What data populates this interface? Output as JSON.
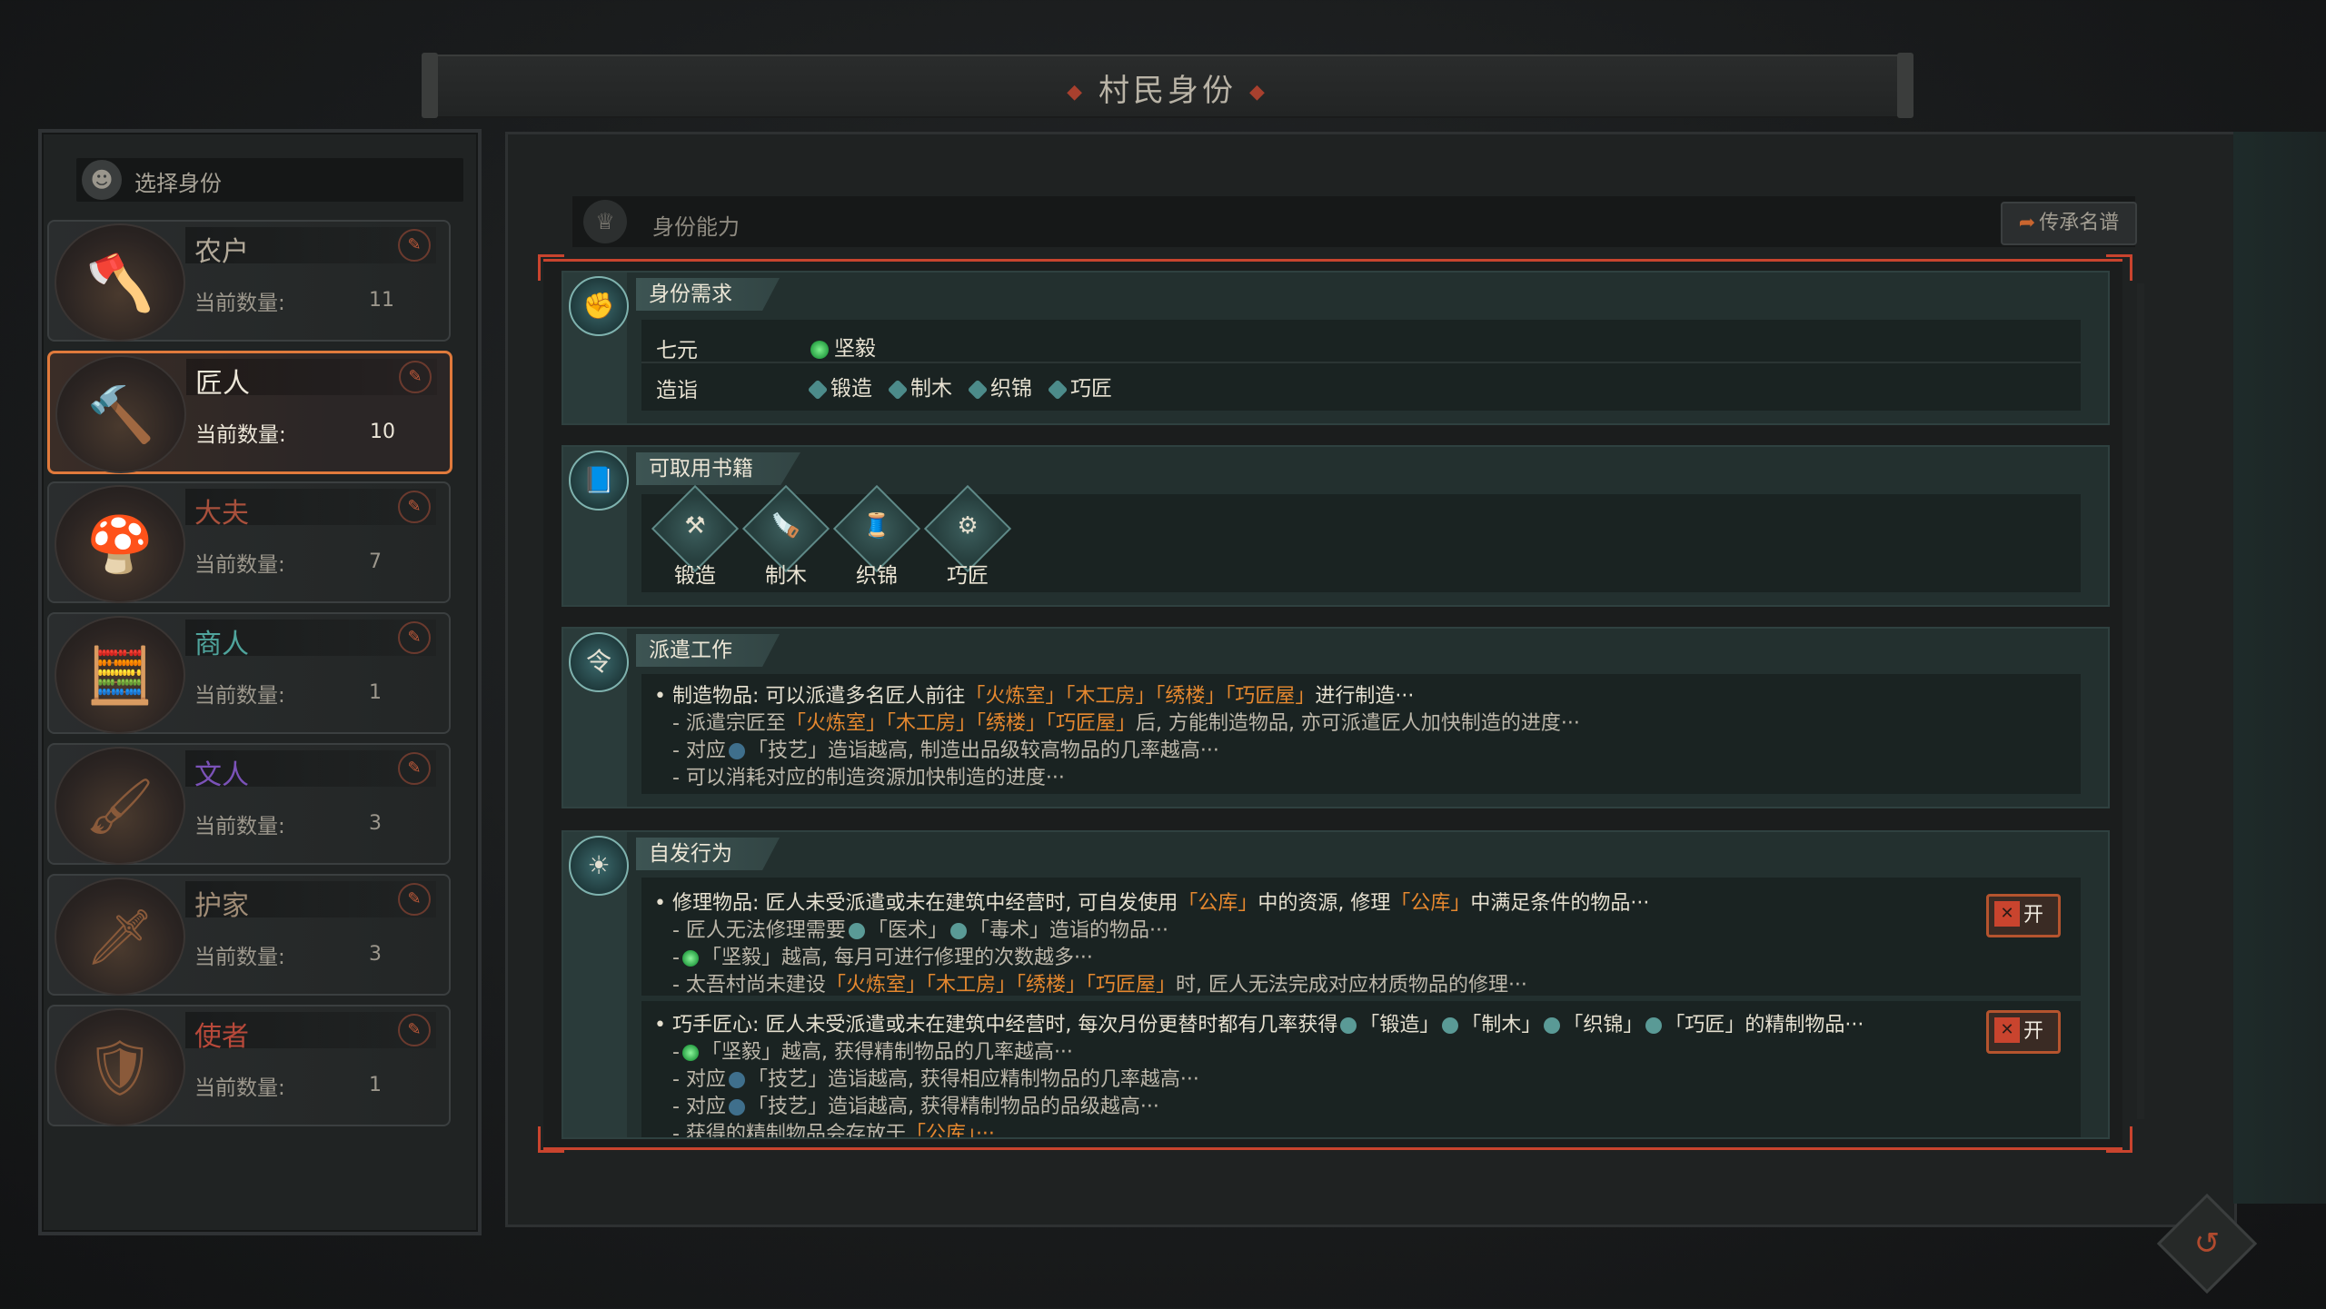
{
  "title": "村民身份",
  "left": {
    "header": "选择身份",
    "count_label": "当前数量:",
    "cards": [
      {
        "name": "农户",
        "count": "11",
        "color": "#b3aa9a",
        "icon": "🪓"
      },
      {
        "name": "匠人",
        "count": "10",
        "color": "#ece6d8",
        "icon": "🔨"
      },
      {
        "name": "大夫",
        "count": "7",
        "color": "#a8503c",
        "icon": "🍄"
      },
      {
        "name": "商人",
        "count": "1",
        "color": "#4fa49c",
        "icon": "🧮"
      },
      {
        "name": "文人",
        "count": "3",
        "color": "#7b52b8",
        "icon": "🖌"
      },
      {
        "name": "护家",
        "count": "3",
        "color": "#a08c76",
        "icon": "🗡"
      },
      {
        "name": "使者",
        "count": "1",
        "color": "#b8493a",
        "icon": "🛡"
      }
    ]
  },
  "ability": {
    "header": "身份能力",
    "legacy_button": "传承名谱"
  },
  "requirements": {
    "title": "身份需求",
    "rows": [
      {
        "key": "七元",
        "values": [
          "坚毅"
        ]
      },
      {
        "key": "造诣",
        "values": [
          "锻造",
          "制木",
          "织锦",
          "巧匠"
        ]
      }
    ]
  },
  "books": {
    "title": "可取用书籍",
    "items": [
      {
        "label": "锻造",
        "glyph": "⚒"
      },
      {
        "label": "制木",
        "glyph": "🪚"
      },
      {
        "label": "织锦",
        "glyph": "🧵"
      },
      {
        "label": "巧匠",
        "glyph": "⚙"
      }
    ]
  },
  "dispatch": {
    "title": "派遣工作",
    "main_prefix": "• 制造物品: 可以派遣多名匠人前往",
    "main_places": "「火炼室」「木工房」「绣楼」「巧匠屋」",
    "main_suffix": "进行制造···",
    "sub1_prefix": "- 派遣宗匠至",
    "sub1_places": "「火炼室」「木工房」「绣楼」「巧匠屋」",
    "sub1_suffix": "后, 方能制造物品, 亦可派遣匠人加快制造的进度···",
    "sub2_prefix": "- 对应",
    "sub2_suffix": "「技艺」造诣越高, 制造出品级较高物品的几率越高···",
    "sub3": "- 可以消耗对应的制造资源加快制造的进度···"
  },
  "spontaneous": {
    "title": "自发行为",
    "toggle_label": "开",
    "repair": {
      "main_a": "• 修理物品: 匠人未受派遣或未在建筑中经营时, 可自发使用",
      "store": "「公库」",
      "main_b": "中的资源, 修理",
      "main_c": "中满足条件的物品···",
      "sub1_a": "- 匠人无法修理需要",
      "sub1_b": "「医术」",
      "sub1_c": "「毒术」造诣的物品···",
      "sub2_a": "-",
      "sub2_b": "「坚毅」越高, 每月可进行修理的次数越多···",
      "sub3_a": "- 太吾村尚未建设",
      "sub3_places": "「火炼室」「木工房」「绣楼」「巧匠屋」",
      "sub3_b": "时, 匠人无法完成对应材质物品的修理···"
    },
    "craft": {
      "main_a": "• 巧手匠心: 匠人未受派遣或未在建筑中经营时, 每次月份更替时都有几率获得",
      "main_b": "「锻造」",
      "main_c": "「制木」",
      "main_d": "「织锦」",
      "main_e": "「巧匠」的精制物品···",
      "sub1_a": "-",
      "sub1_b": "「坚毅」越高, 获得精制物品的几率越高···",
      "sub2_a": "- 对应",
      "sub2_b": "「技艺」造诣越高, 获得相应精制物品的几率越高···",
      "sub3_a": "- 对应",
      "sub3_b": "「技艺」造诣越高, 获得精制物品的品级越高···",
      "sub4_a": "- 获得的精制物品会存放于",
      "sub4_b": "「公库」···"
    }
  }
}
